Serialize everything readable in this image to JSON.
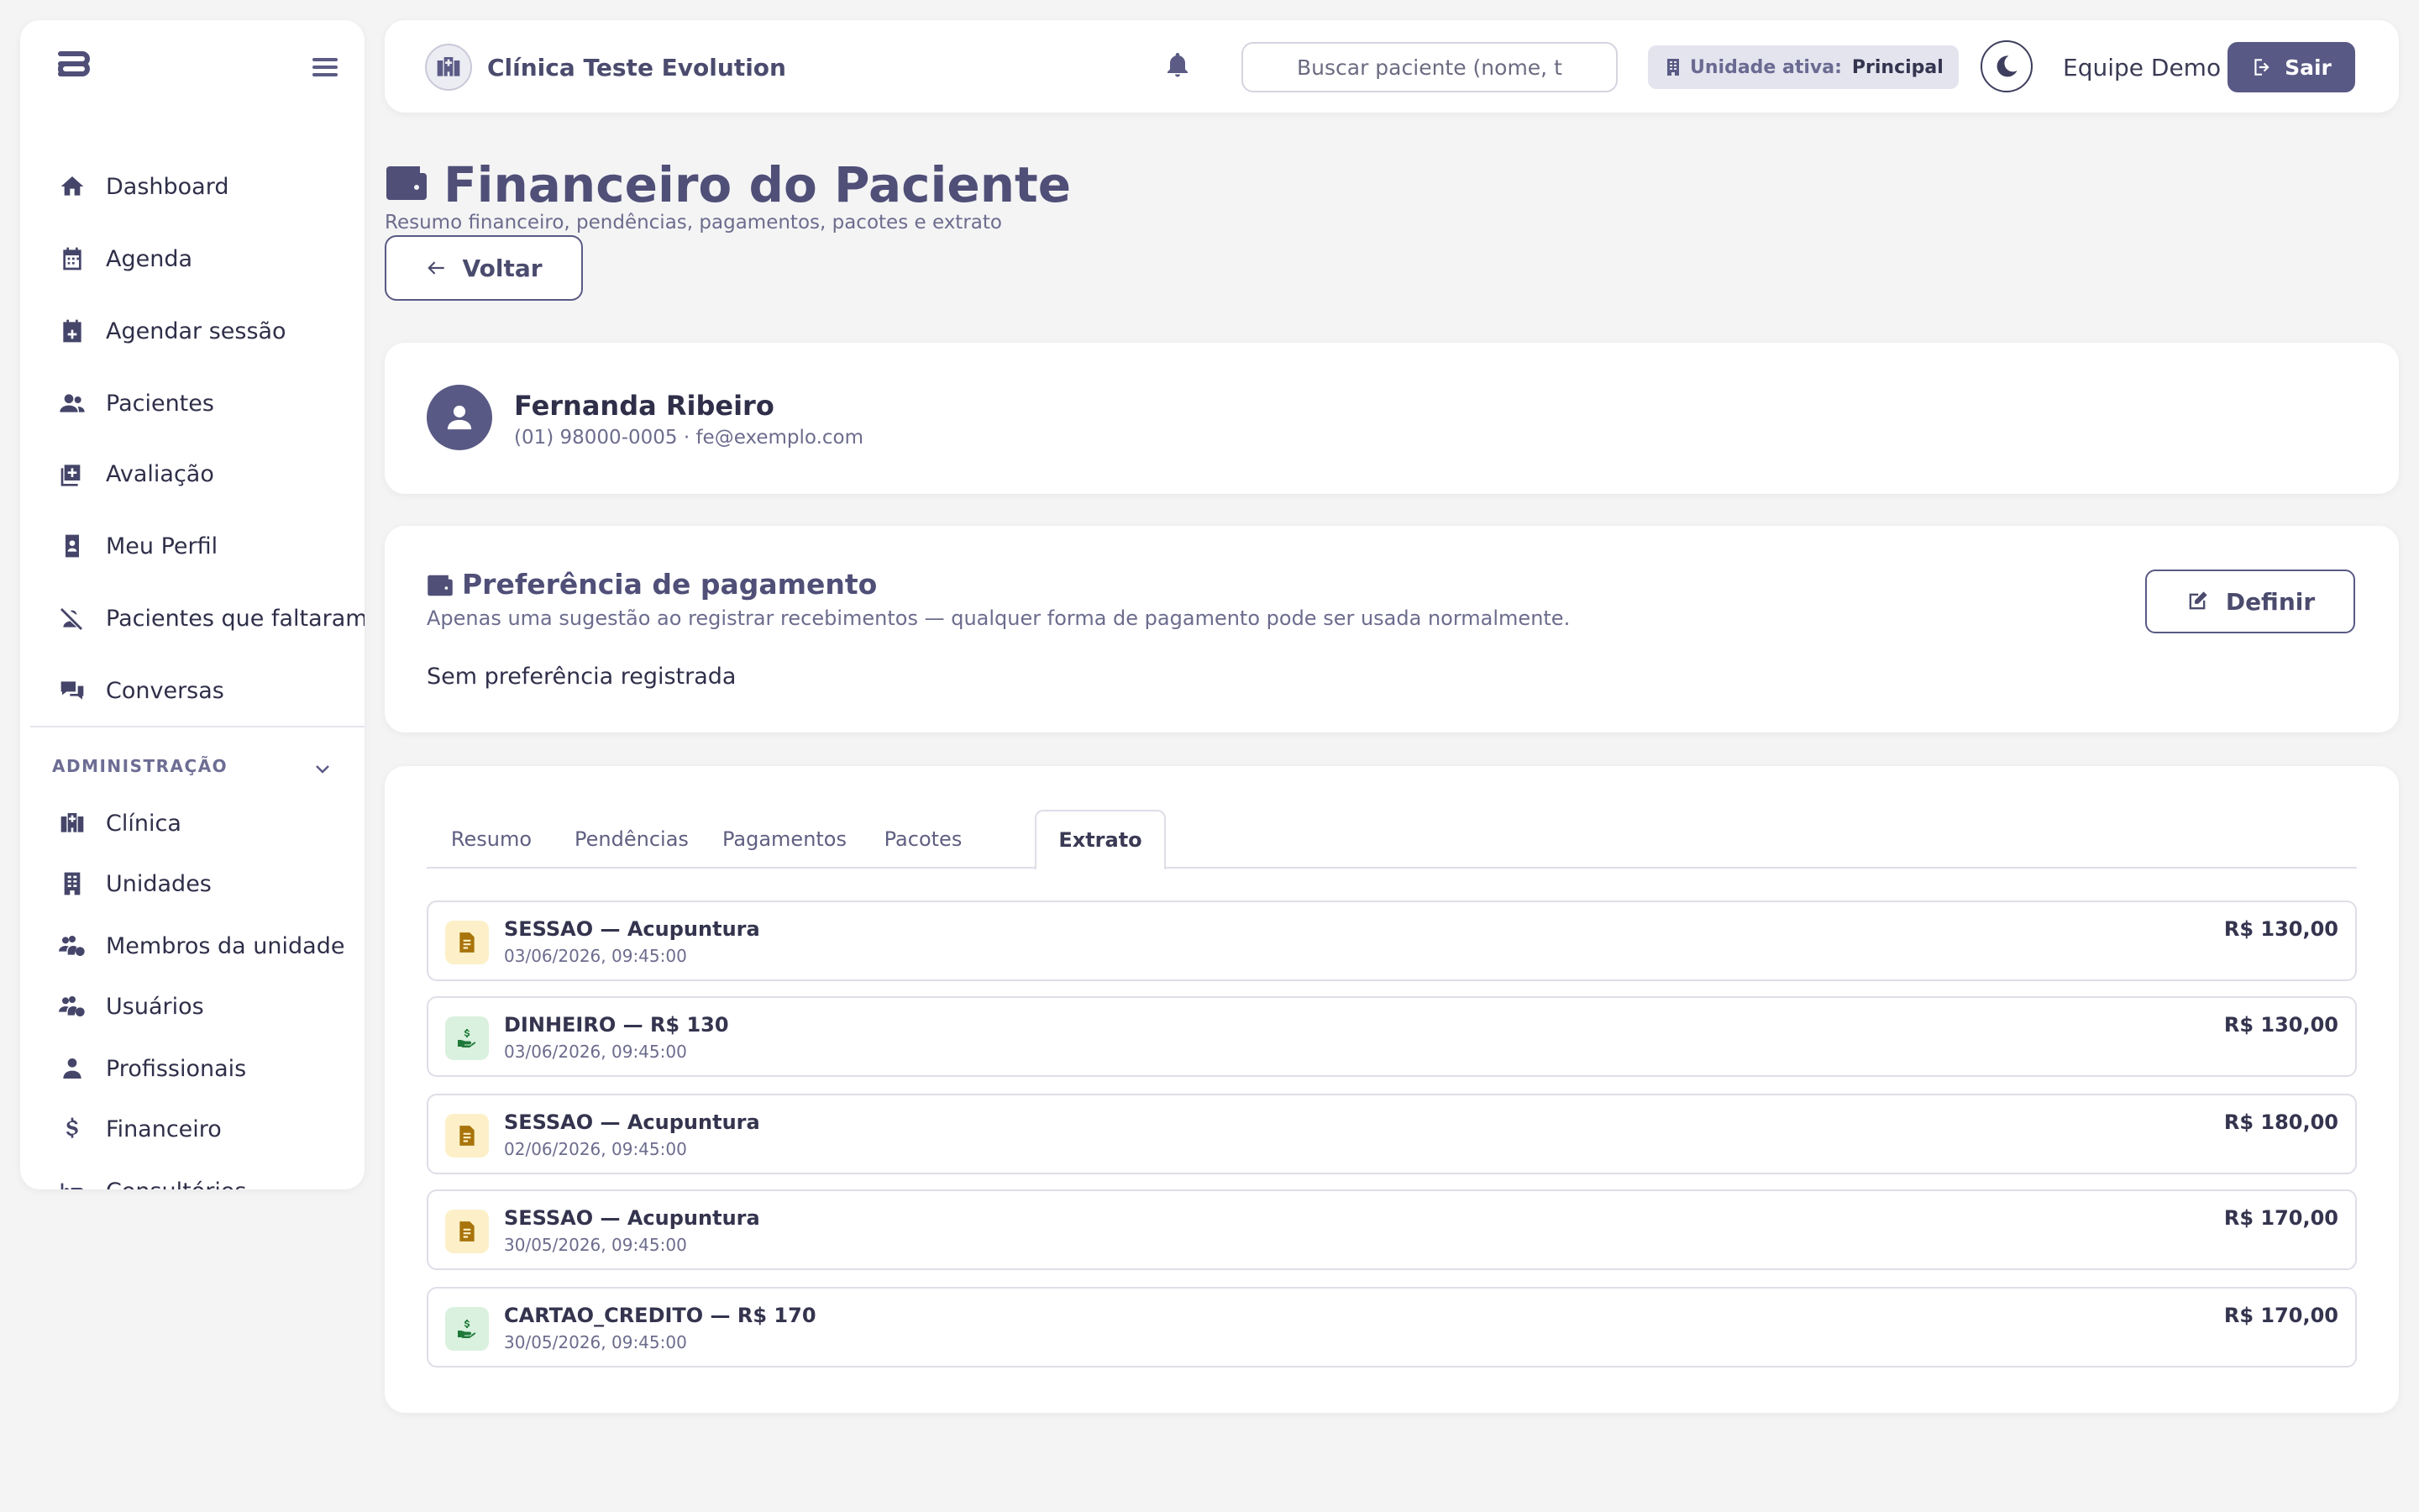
{
  "sidebar": {
    "nav_items": [
      {
        "label": "Dashboard",
        "icon": "home-icon"
      },
      {
        "label": "Agenda",
        "icon": "calendar-icon"
      },
      {
        "label": "Agendar sessão",
        "icon": "calendar-plus-icon"
      },
      {
        "label": "Pacientes",
        "icon": "users-icon"
      },
      {
        "label": "Avaliação",
        "icon": "clipboard-plus-icon"
      },
      {
        "label": "Meu Perfil",
        "icon": "id-badge-icon"
      },
      {
        "label": "Pacientes que faltaram",
        "icon": "user-slash-icon"
      },
      {
        "label": "Conversas",
        "icon": "chat-icon"
      }
    ],
    "admin_section_label": "ADMINISTRAÇÃO",
    "admin_items": [
      {
        "label": "Clínica",
        "icon": "hospital-icon"
      },
      {
        "label": "Unidades",
        "icon": "building-icon"
      },
      {
        "label": "Membros da unidade",
        "icon": "users-gear-icon"
      },
      {
        "label": "Usuários",
        "icon": "users-gear-icon"
      },
      {
        "label": "Profissionais",
        "icon": "user-doctor-icon"
      },
      {
        "label": "Financeiro",
        "icon": "dollar-icon"
      },
      {
        "label": "Consultórios",
        "icon": "bed-icon"
      }
    ]
  },
  "header": {
    "clinic_name": "Clínica Teste Evolution",
    "search_placeholder": "Buscar paciente (nome, t",
    "unit_label": "Unidade ativa:",
    "unit_value": "Principal",
    "user_name": "Equipe Demo",
    "logout_label": "Sair"
  },
  "page": {
    "title": "Financeiro do Paciente",
    "subtitle": "Resumo financeiro, pendências, pagamentos, pacotes e extrato",
    "back_label": "Voltar"
  },
  "patient": {
    "name": "Fernanda Ribeiro",
    "contact": "(01) 98000-0005 · fe@exemplo.com"
  },
  "preference": {
    "title": "Preferência de pagamento",
    "description": "Apenas uma sugestão ao registrar recebimentos — qualquer forma de pagamento pode ser usada normalmente.",
    "value": "Sem preferência registrada",
    "define_label": "Definir"
  },
  "tabs": [
    {
      "label": "Resumo"
    },
    {
      "label": "Pendências"
    },
    {
      "label": "Pagamentos"
    },
    {
      "label": "Pacotes"
    },
    {
      "label": "Extrato",
      "active": true
    }
  ],
  "statement": [
    {
      "kind": "debit",
      "title": "SESSAO — Acupuntura",
      "date": "03/06/2026, 09:45:00",
      "amount": "R$ 130,00"
    },
    {
      "kind": "credit",
      "title": "DINHEIRO — R$ 130",
      "date": "03/06/2026, 09:45:00",
      "amount": "R$ 130,00"
    },
    {
      "kind": "debit",
      "title": "SESSAO — Acupuntura",
      "date": "02/06/2026, 09:45:00",
      "amount": "R$ 180,00"
    },
    {
      "kind": "debit",
      "title": "SESSAO — Acupuntura",
      "date": "30/05/2026, 09:45:00",
      "amount": "R$ 170,00"
    },
    {
      "kind": "credit",
      "title": "CARTAO_CREDITO — R$ 170",
      "date": "30/05/2026, 09:45:00",
      "amount": "R$ 170,00"
    }
  ],
  "colors": {
    "accent": "#595985",
    "debit_bg": "#fdf0c8",
    "credit_bg": "#d9f1de"
  }
}
